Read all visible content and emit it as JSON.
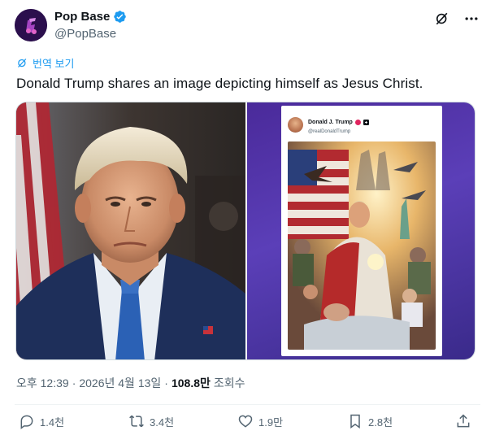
{
  "author": {
    "display_name": "Pop Base",
    "handle": "@PopBase",
    "verified": true,
    "verified_color": "#1d9bf0"
  },
  "translate_label": "번역 보기",
  "tweet_text": "Donald Trump shares an image depicting himself as Jesus Christ.",
  "embedded_post": {
    "name": "Donald J. Trump",
    "handle": "@realDonaldTrump"
  },
  "meta": {
    "time": "오후 12:39",
    "separator": "·",
    "date": "2026년 4월 13일",
    "views_count": "108.8만",
    "views_label": "조회수"
  },
  "actions": {
    "replies": "1.4천",
    "reposts": "3.4천",
    "likes": "1.9만",
    "bookmarks": "2.8천"
  },
  "icons": [
    "grok-icon",
    "more-icon",
    "translate-icon",
    "reply-icon",
    "repost-icon",
    "like-icon",
    "bookmark-icon",
    "share-icon"
  ],
  "colors": {
    "accent": "#1d9bf0",
    "text": "#0f1419",
    "secondary": "#536471"
  }
}
